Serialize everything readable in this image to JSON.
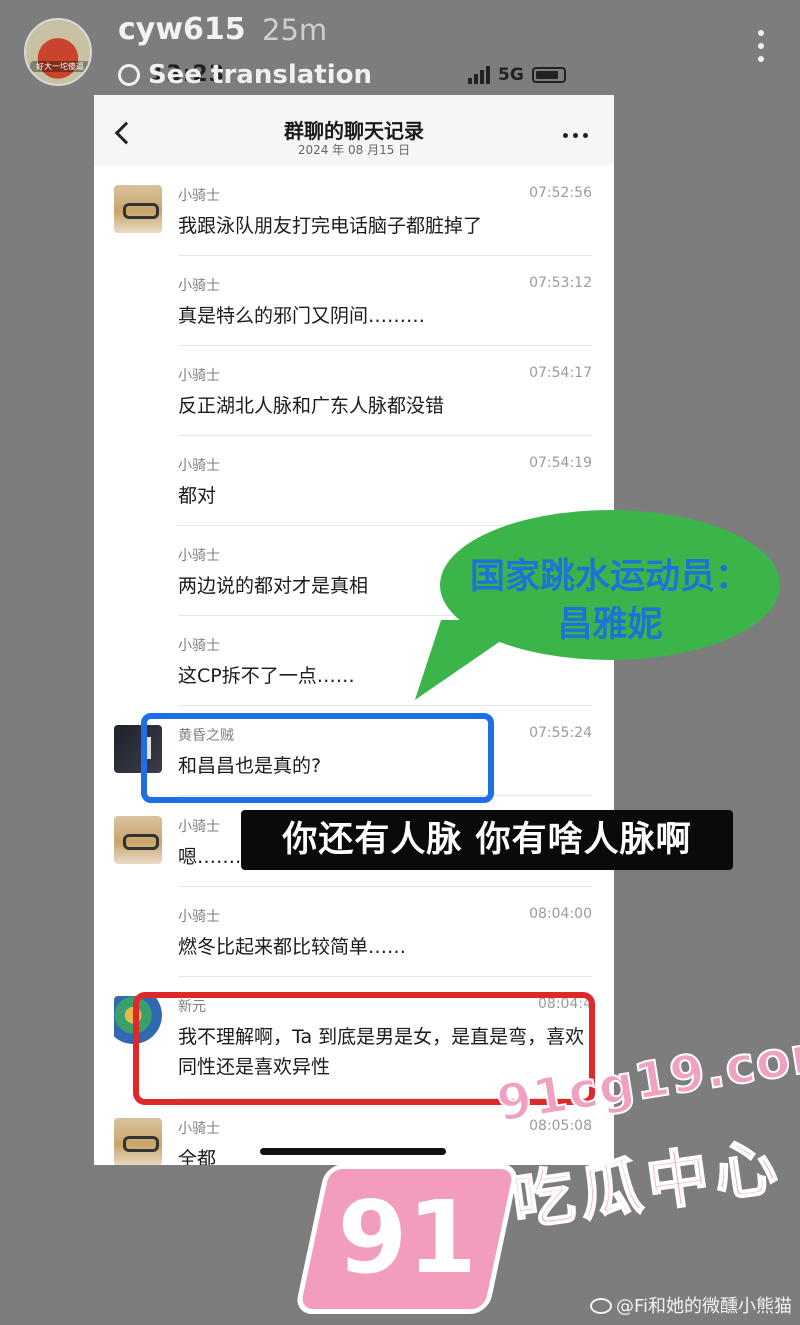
{
  "story": {
    "username": "cyw615",
    "time_ago": "25m",
    "see_translation": "See translation",
    "avatar_text": "好大一坨傻逼",
    "phone_clock": "13:23",
    "network": "5G"
  },
  "chat": {
    "title": "群聊的聊天记录",
    "date": "2024 年 08 月15 日",
    "messages": [
      {
        "name": "小骑士",
        "time": "07:52:56",
        "text": "我跟泳队朋友打完电话脑子都脏掉了",
        "avatar": "dog"
      },
      {
        "name": "小骑士",
        "time": "07:53:12",
        "text": "真是特么的邪门又阴间………",
        "avatar": ""
      },
      {
        "name": "小骑士",
        "time": "07:54:17",
        "text": "反正湖北人脉和广东人脉都没错",
        "avatar": ""
      },
      {
        "name": "小骑士",
        "time": "07:54:19",
        "text": "都对",
        "avatar": ""
      },
      {
        "name": "小骑士",
        "time": "",
        "text": "两边说的都对才是真相",
        "avatar": ""
      },
      {
        "name": "小骑士",
        "time": "",
        "text": "这CP拆不了一点……",
        "avatar": ""
      },
      {
        "name": "黄昏之贼",
        "time": "07:55:24",
        "text": "和昌昌也是真的?",
        "avatar": "dark"
      },
      {
        "name": "小骑士",
        "time": "",
        "text": "嗯………",
        "avatar": "dog"
      },
      {
        "name": "小骑士",
        "time": "08:04:00",
        "text": "燃冬比起来都比较简单……",
        "avatar": ""
      },
      {
        "name": "新元",
        "time": "08:04:4",
        "text": "我不理解啊，Ta 到底是男是女，是直是弯，喜欢同性还是喜欢异性",
        "avatar": "color"
      },
      {
        "name": "小骑士",
        "time": "08:05:08",
        "text": "全都",
        "avatar": "dog"
      }
    ]
  },
  "annotations": {
    "bubble_line1": "国家跳水运动员：",
    "bubble_line2": "昌雅妮",
    "caption": "你还有人脉 你有啥人脉啊",
    "colors": {
      "blue_box": "#1e6fe6",
      "red_box": "#e02828",
      "bubble": "#3bb54a",
      "bubble_text": "#1e73d6"
    }
  },
  "watermark": {
    "domain": "91cg19.com",
    "logo_number": "91",
    "chinese": "吃瓜中心",
    "weibo_credit": "@Fi和她的微醺小熊猫"
  }
}
